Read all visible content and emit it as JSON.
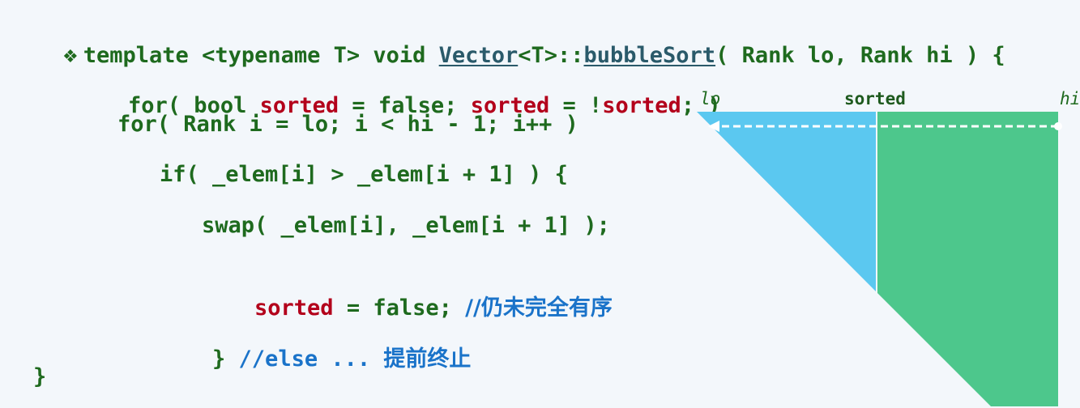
{
  "code": {
    "bullet_glyph": "❖",
    "line1": {
      "pre": "template <typename T> void ",
      "cls": "Vector",
      "mid": "<T>::",
      "fn": "bubbleSort",
      "post": "( Rank lo, Rank hi ) {"
    },
    "line2": {
      "a": "for( bool ",
      "b": "sorted",
      "c": " = false; ",
      "d": "sorted",
      "e": " = !",
      "f": "sorted",
      "g": "; )"
    },
    "line3": "for( Rank i = lo; i < hi - 1; i++ )",
    "line4": "if( _elem[i] > _elem[i + 1] ) {",
    "line5": "swap( _elem[i], _elem[i + 1] );",
    "line6": {
      "a": "sorted",
      "b": " = false; ",
      "c": "//仍未完全有序"
    },
    "line7": {
      "a": "} ",
      "b": "//else ... ",
      "c": "提前终止"
    },
    "line8": "}"
  },
  "diagram": {
    "label_lo": "lo",
    "label_sorted": "sorted",
    "label_hi": "hi",
    "colors": {
      "unsorted": "#5bc8f0",
      "sorted": "#4dc78c",
      "arrow": "#ffffff",
      "label": "#1e5a1e"
    }
  }
}
